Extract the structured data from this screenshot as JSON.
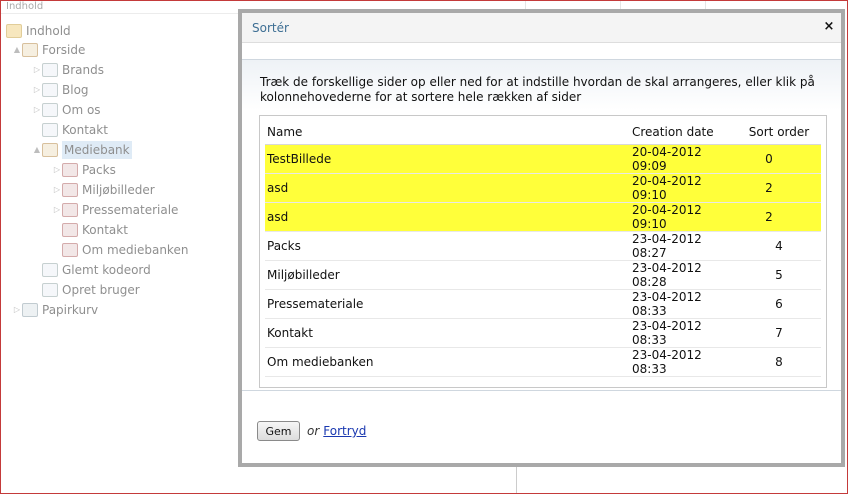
{
  "tree": {
    "header": "Indhold",
    "nodes": [
      {
        "label": "Indhold",
        "icon": "folder-icon"
      },
      {
        "label": "Forside",
        "icon": "home-icon"
      },
      {
        "label": "Brands",
        "icon": "page-icon"
      },
      {
        "label": "Blog",
        "icon": "page-icon"
      },
      {
        "label": "Om os",
        "icon": "page-icon"
      },
      {
        "label": "Kontakt",
        "icon": "page-icon"
      },
      {
        "label": "Mediebank",
        "icon": "home-icon"
      },
      {
        "label": "Packs",
        "icon": "image-folder-icon"
      },
      {
        "label": "Miljøbilleder",
        "icon": "image-folder-icon"
      },
      {
        "label": "Pressemateriale",
        "icon": "image-folder-icon"
      },
      {
        "label": "Kontakt",
        "icon": "image-folder-icon"
      },
      {
        "label": "Om mediebanken",
        "icon": "image-folder-icon"
      },
      {
        "label": "Glemt kodeord",
        "icon": "page-icon"
      },
      {
        "label": "Opret bruger",
        "icon": "page-icon"
      },
      {
        "label": "Papirkurv",
        "icon": "trash-icon"
      }
    ]
  },
  "modal": {
    "title": "Sortér",
    "close_label": "×",
    "instructions": "Træk de forskellige sider op eller ned for at indstille hvordan de skal arrangeres, eller klik på kolonnehovederne for at sortere hele rækken af sider",
    "columns": [
      "Name",
      "Creation date",
      "Sort order"
    ],
    "rows": [
      {
        "name": "TestBillede",
        "date": "20-04-2012 09:09",
        "order": "0",
        "highlighted": true
      },
      {
        "name": "asd",
        "date": "20-04-2012 09:10",
        "order": "2",
        "highlighted": true
      },
      {
        "name": "asd",
        "date": "20-04-2012 09:10",
        "order": "2",
        "highlighted": true
      },
      {
        "name": "Packs",
        "date": "23-04-2012 08:27",
        "order": "4",
        "highlighted": false
      },
      {
        "name": "Miljøbilleder",
        "date": "23-04-2012 08:28",
        "order": "5",
        "highlighted": false
      },
      {
        "name": "Pressemateriale",
        "date": "23-04-2012 08:33",
        "order": "6",
        "highlighted": false
      },
      {
        "name": "Kontakt",
        "date": "23-04-2012 08:33",
        "order": "7",
        "highlighted": false
      },
      {
        "name": "Om mediebanken",
        "date": "23-04-2012 08:33",
        "order": "8",
        "highlighted": false
      }
    ],
    "save_label": "Gem",
    "or_label": "or",
    "cancel_label": "Fortryd"
  },
  "colors": {
    "highlight": "#ffff3a",
    "title": "#3e6f94",
    "link": "#1a38b0"
  }
}
